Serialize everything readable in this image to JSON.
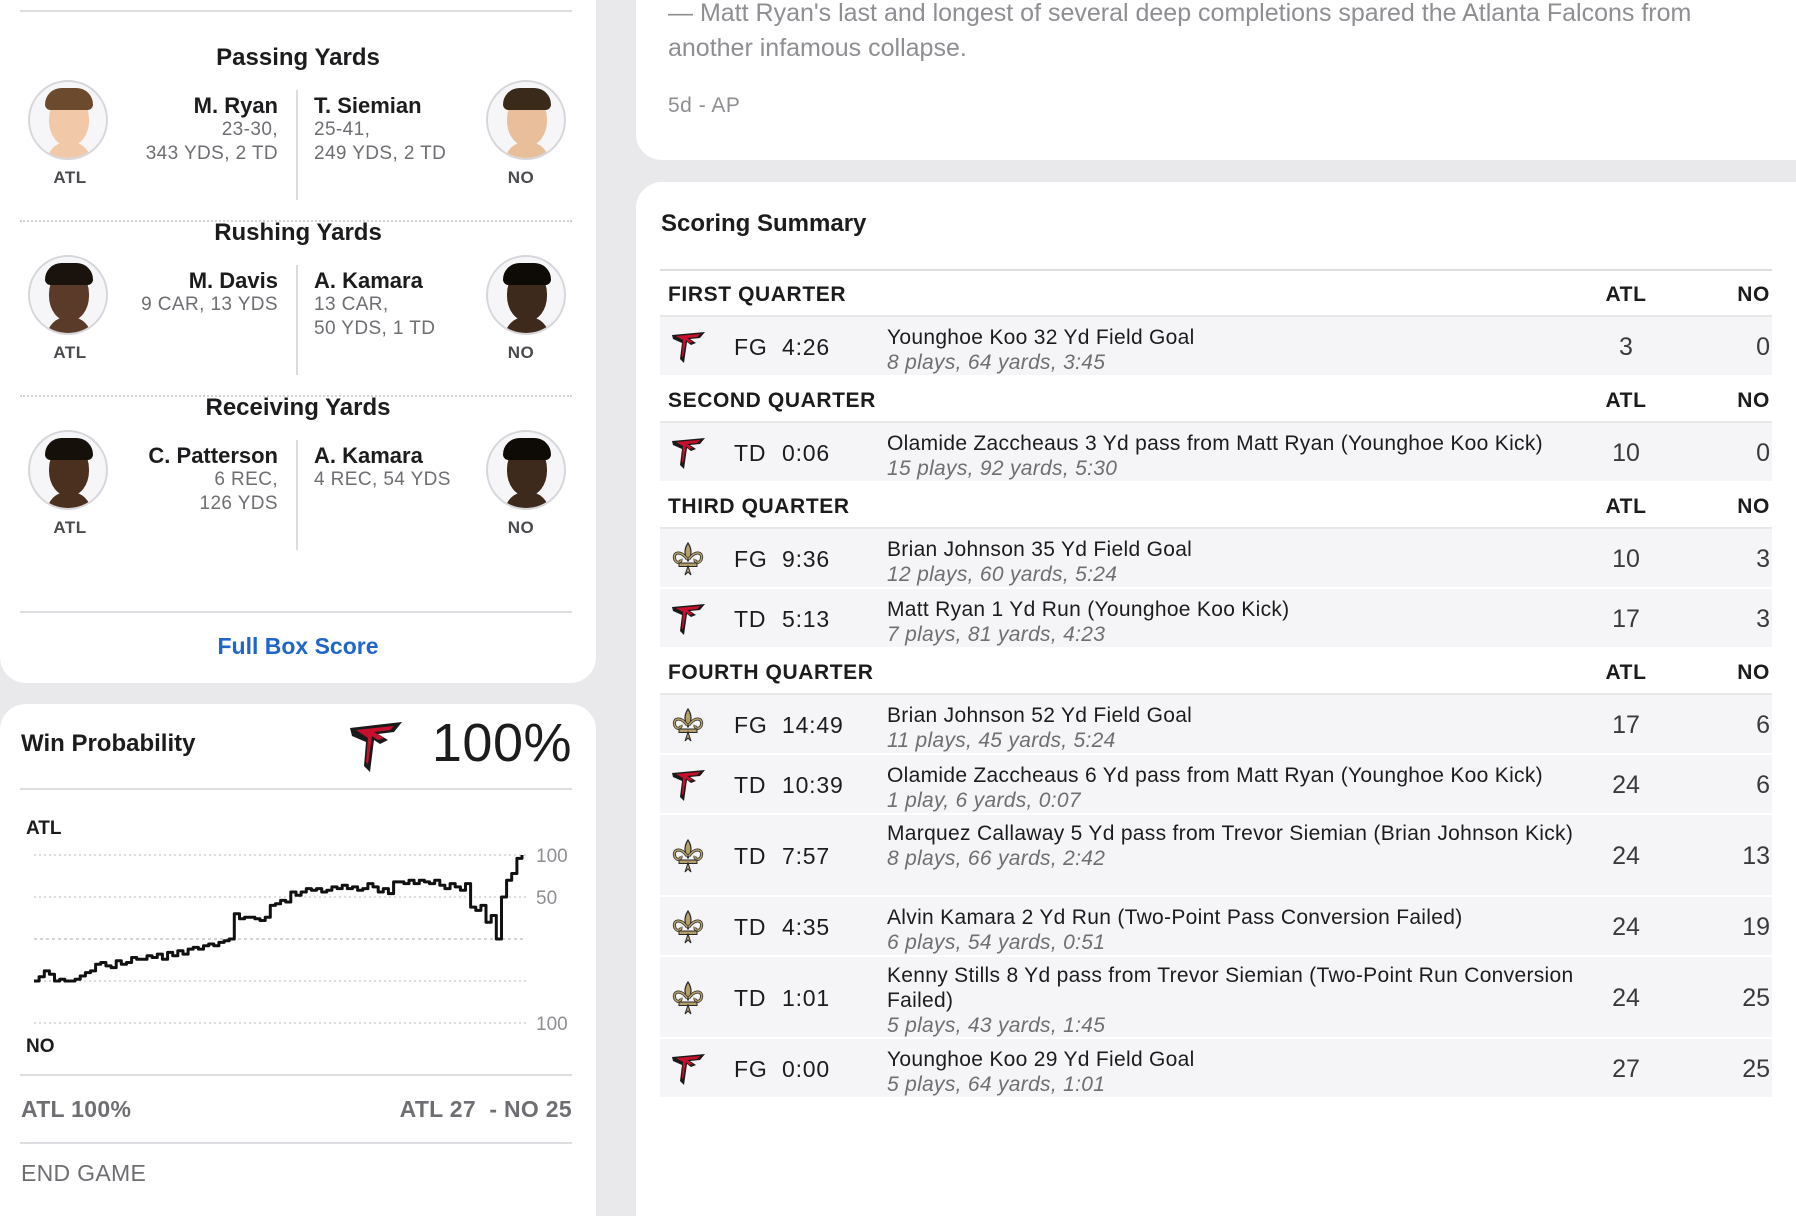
{
  "leaders": {
    "categories": [
      {
        "title": "Passing Yards",
        "left": {
          "name": "M. Ryan",
          "stat1": "23-30,",
          "stat2": "343 YDS, 2 TD",
          "stat3": "",
          "team": "ATL"
        },
        "right": {
          "name": "T. Siemian",
          "stat1": "25-41,",
          "stat2": "249 YDS, 2 TD",
          "stat3": "",
          "team": "NO"
        }
      },
      {
        "title": "Rushing Yards",
        "left": {
          "name": "M. Davis",
          "stat1": "9 CAR, 13 YDS",
          "stat2": "",
          "stat3": "",
          "team": "ATL"
        },
        "right": {
          "name": "A. Kamara",
          "stat1": "13 CAR,",
          "stat2": "50 YDS, 1 TD",
          "stat3": "",
          "team": "NO"
        }
      },
      {
        "title": "Receiving Yards",
        "left": {
          "name": "C. Patterson",
          "stat1": "6 REC,",
          "stat2": "126 YDS",
          "stat3": "",
          "team": "ATL"
        },
        "right": {
          "name": "A. Kamara",
          "stat1": "4 REC, 54 YDS",
          "stat2": "",
          "stat3": "",
          "team": "NO"
        }
      }
    ],
    "full_box_score": "Full Box Score"
  },
  "win_probability": {
    "title": "Win Probability",
    "percent": "100%",
    "team_top": "ATL",
    "team_bottom": "NO",
    "axis_labels": [
      "100",
      "50",
      "100"
    ],
    "footer_left": "ATL 100%",
    "footer_right": "ATL 27  - NO 25",
    "status": "END GAME",
    "chart_data": {
      "type": "line",
      "title": "",
      "xlabel": "",
      "ylabel": "",
      "ylim": [
        -100,
        100
      ],
      "series": [
        {
          "values": [
            -50,
            -45,
            -38,
            -42,
            -50,
            -48,
            -50,
            -50,
            -48,
            -44,
            -40,
            -38,
            -30,
            -28,
            -32,
            -34,
            -26,
            -30,
            -28,
            -22,
            -24,
            -24,
            -20,
            -22,
            -18,
            -24,
            -16,
            -20,
            -14,
            -18,
            -12,
            -10,
            -12,
            -8,
            -6,
            -8,
            -4,
            -2,
            0,
            30,
            24,
            26,
            26,
            24,
            22,
            26,
            40,
            42,
            46,
            44,
            56,
            52,
            56,
            60,
            58,
            60,
            56,
            58,
            62,
            60,
            64,
            60,
            62,
            58,
            60,
            66,
            62,
            56,
            60,
            54,
            68,
            68,
            66,
            70,
            66,
            70,
            68,
            66,
            70,
            64,
            60,
            66,
            62,
            58,
            66,
            38,
            34,
            40,
            20,
            28,
            0,
            50,
            70,
            78,
            96,
            100
          ]
        }
      ],
      "colors": {
        "line": "#111111",
        "grid": "#c6c6cc"
      }
    }
  },
  "news": {
    "text": "— Matt Ryan's last and longest of several deep completions spared the Atlanta Falcons from another infamous collapse.",
    "meta": "5d - AP"
  },
  "scoring": {
    "title": "Scoring Summary",
    "col_atl": "ATL",
    "col_no": "NO",
    "quarters": [
      {
        "name": "FIRST QUARTER",
        "plays": [
          {
            "team": "ATL",
            "type": "FG",
            "time": "4:26",
            "desc": "Younghoe Koo 32 Yd Field Goal",
            "detail": "8 plays, 64 yards, 3:45",
            "atl": "3",
            "no": "0"
          }
        ]
      },
      {
        "name": "SECOND QUARTER",
        "plays": [
          {
            "team": "ATL",
            "type": "TD",
            "time": "0:06",
            "desc": "Olamide Zaccheaus 3 Yd pass from Matt Ryan (Younghoe Koo Kick)",
            "detail": "15 plays, 92 yards, 5:30",
            "atl": "10",
            "no": "0"
          }
        ]
      },
      {
        "name": "THIRD QUARTER",
        "plays": [
          {
            "team": "NO",
            "type": "FG",
            "time": "9:36",
            "desc": "Brian Johnson 35 Yd Field Goal",
            "detail": "12 plays, 60 yards, 5:24",
            "atl": "10",
            "no": "3"
          },
          {
            "team": "ATL",
            "type": "TD",
            "time": "5:13",
            "desc": "Matt Ryan 1 Yd Run (Younghoe Koo Kick)",
            "detail": "7 plays, 81 yards, 4:23",
            "atl": "17",
            "no": "3"
          }
        ]
      },
      {
        "name": "FOURTH QUARTER",
        "plays": [
          {
            "team": "NO",
            "type": "FG",
            "time": "14:49",
            "desc": "Brian Johnson 52 Yd Field Goal",
            "detail": "11 plays, 45 yards, 5:24",
            "atl": "17",
            "no": "6"
          },
          {
            "team": "ATL",
            "type": "TD",
            "time": "10:39",
            "desc": "Olamide Zaccheaus 6 Yd pass from Matt Ryan (Younghoe Koo Kick)",
            "detail": "1 play, 6 yards, 0:07",
            "atl": "24",
            "no": "6"
          },
          {
            "team": "NO",
            "type": "TD",
            "time": "7:57",
            "desc": "Marquez Callaway 5 Yd pass from Trevor Siemian (Brian Johnson Kick)",
            "detail": "8 plays, 66 yards, 2:42",
            "atl": "24",
            "no": "13"
          },
          {
            "team": "NO",
            "type": "TD",
            "time": "4:35",
            "desc": "Alvin Kamara 2 Yd Run (Two-Point Pass Conversion Failed)",
            "detail": "6 plays, 54 yards, 0:51",
            "atl": "24",
            "no": "19"
          },
          {
            "team": "NO",
            "type": "TD",
            "time": "1:01",
            "desc": "Kenny Stills 8 Yd pass from Trevor Siemian (Two-Point Run Conversion Failed)",
            "detail": "5 plays, 43 yards, 1:45",
            "atl": "24",
            "no": "25"
          },
          {
            "team": "ATL",
            "type": "FG",
            "time": "0:00",
            "desc": "Younghoe Koo 29 Yd Field Goal",
            "detail": "5 plays, 64 yards, 1:01",
            "atl": "27",
            "no": "25"
          }
        ]
      }
    ]
  },
  "colors": {
    "link": "#1f66c7",
    "falcons_red": "#c8102e",
    "saints_gold": "#b5a06a",
    "muted": "#6e6e73"
  },
  "icons": {
    "atl": "falcons-logo-icon",
    "no": "saints-fleur-de-lis-icon"
  }
}
